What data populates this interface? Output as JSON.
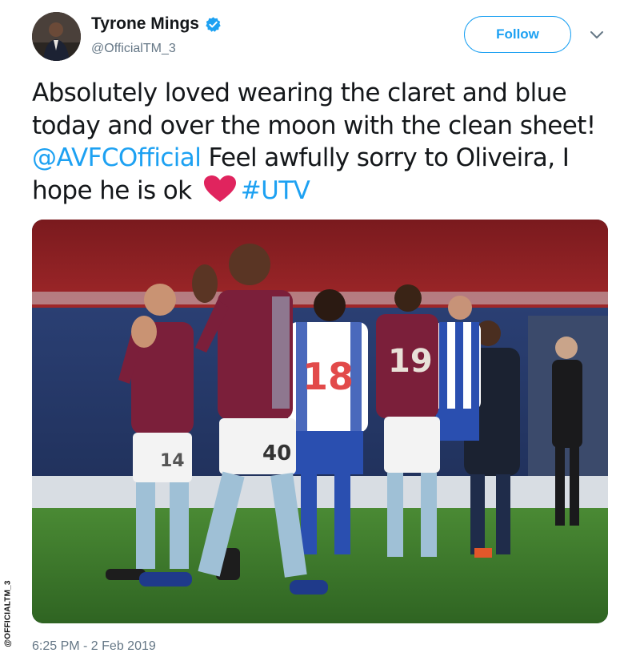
{
  "tweet": {
    "display_name": "Tyrone Mings",
    "handle": "@OfficialTM_3",
    "follow_label": "Follow",
    "text_segments": [
      {
        "text": "Absolutely loved wearing the claret and blue today and over the moon with the clean sheet! ",
        "type": "text"
      },
      {
        "text": "@AVFCOfficial",
        "type": "mention"
      },
      {
        "text": " Feel awfully sorry to Oliveira, I hope he is ok ",
        "type": "text"
      },
      {
        "text": "#UTV",
        "type": "hashtag"
      }
    ],
    "timestamp": "6:25 PM - 2 Feb 2019",
    "watermark": "@OFFICIALTM_3"
  },
  "colors": {
    "link": "#1da1f2",
    "secondary_text": "#657786",
    "heart": "#e0245e",
    "claret": "#7b1f3a",
    "pitch": "#3f7a2b"
  },
  "icons": {
    "verified": "verified-badge-icon",
    "caret": "chevron-down-icon",
    "heart": "red-heart-emoji-icon"
  },
  "photo": {
    "shirt_numbers": [
      "14",
      "40",
      "18",
      "19"
    ]
  }
}
